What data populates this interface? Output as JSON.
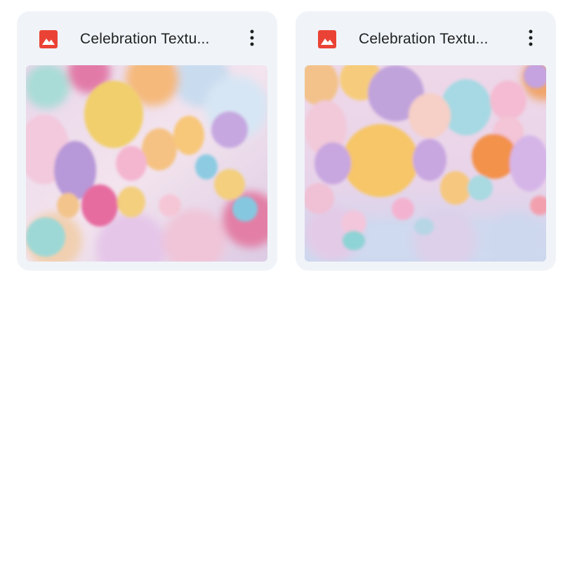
{
  "files": [
    {
      "name": "Celebration Textu...",
      "type_icon": "image-file-icon",
      "menu_icon": "more-vert-icon",
      "icon_color": "#ea4335"
    },
    {
      "name": "Celebration Textu...",
      "type_icon": "image-file-icon",
      "menu_icon": "more-vert-icon",
      "icon_color": "#ea4335"
    }
  ],
  "colors": {
    "card_background": "#f0f4f9",
    "title_text": "#1f1f1f",
    "page_background": "#ffffff"
  }
}
